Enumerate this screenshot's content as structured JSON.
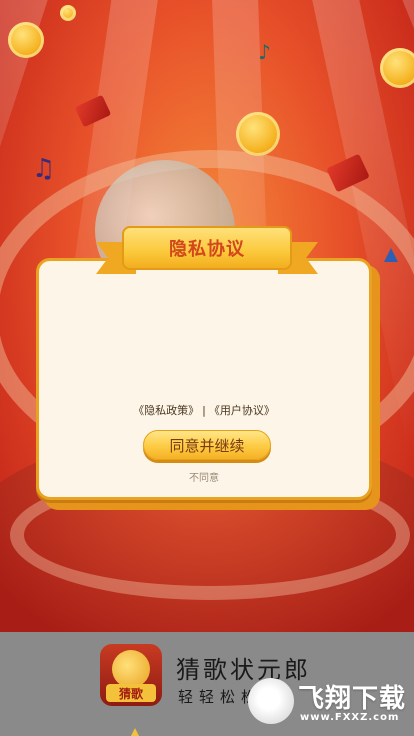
{
  "dialog": {
    "title": "隐私协议",
    "privacy_policy_link": "《隐私政策》",
    "separator": "|",
    "user_agreement_link": "《用户协议》",
    "agree_button": "同意并继续",
    "decline_link": "不同意"
  },
  "banner": {
    "app_icon_label": "猜歌",
    "app_name": "猜歌状元郎",
    "app_tagline": "轻轻松松",
    "watermark_text": "飞翔下载",
    "watermark_url": "www.FXXZ.com"
  },
  "colors": {
    "background": "#e8522a",
    "dialog_bg": "#fdf6e8",
    "accent_gold": "#fbc93b",
    "title_text": "#d2471b"
  },
  "icons": [
    "music-note-icon",
    "coin-icon",
    "red-packet-icon",
    "microphone-icon",
    "app-icon",
    "watermark-logo-icon"
  ]
}
